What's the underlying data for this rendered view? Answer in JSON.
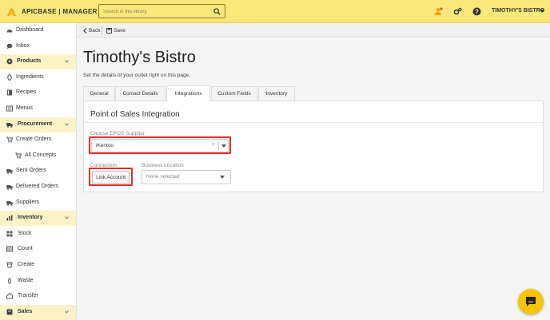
{
  "topbar": {
    "brand": "APICBASE | MANAGER",
    "search_placeholder": "Search in this library.",
    "user": "TIMOTHY'S BISTRO"
  },
  "sidebar": {
    "items": [
      {
        "label": "Dashboard",
        "icon": "dashboard-icon",
        "section": false
      },
      {
        "label": "Inbox",
        "icon": "inbox-icon",
        "section": false
      },
      {
        "label": "Products",
        "icon": "products-icon",
        "section": true
      },
      {
        "label": "Ingredients",
        "icon": "ingredients-icon",
        "section": false
      },
      {
        "label": "Recipes",
        "icon": "recipes-icon",
        "section": false
      },
      {
        "label": "Menus",
        "icon": "menus-icon",
        "section": false
      },
      {
        "label": "Procurement",
        "icon": "procurement-icon",
        "section": true
      },
      {
        "label": "Create Orders",
        "icon": "cart-icon",
        "section": false
      },
      {
        "label": "All Concepts",
        "icon": "cart-icon",
        "section": false
      },
      {
        "label": "Sent Orders",
        "icon": "sent-icon",
        "section": false
      },
      {
        "label": "Delivered Orders",
        "icon": "truck-icon",
        "section": false
      },
      {
        "label": "Suppliers",
        "icon": "suppliers-icon",
        "section": false
      },
      {
        "label": "Inventory",
        "icon": "inventory-icon",
        "section": true
      },
      {
        "label": "Stock",
        "icon": "stock-icon",
        "section": false
      },
      {
        "label": "Count",
        "icon": "count-icon",
        "section": false
      },
      {
        "label": "Create",
        "icon": "create-icon",
        "section": false
      },
      {
        "label": "Waste",
        "icon": "waste-icon",
        "section": false
      },
      {
        "label": "Transfer",
        "icon": "transfer-icon",
        "section": false
      },
      {
        "label": "Sales",
        "icon": "sales-icon",
        "section": true
      }
    ]
  },
  "toolbar": {
    "back_label": "Back",
    "save_label": "Save"
  },
  "page": {
    "title": "Timothy's Bistro",
    "description": "Set the details of your outlet right on this page."
  },
  "tabs": [
    {
      "label": "General",
      "active": false
    },
    {
      "label": "Contact Details",
      "active": false
    },
    {
      "label": "Integrations",
      "active": true
    },
    {
      "label": "Custom Fields",
      "active": false
    },
    {
      "label": "Inventory",
      "active": false
    }
  ],
  "integration": {
    "title": "Point of Sales Integration",
    "supplier_label": "Choose EPOS Supplier",
    "supplier_value": "iKentoo",
    "connection_label": "Connection",
    "link_button": "Link Account",
    "location_label": "Business Location",
    "location_value": "None selected",
    "clear_glyph": "×"
  },
  "colors": {
    "accent": "#fbe77a",
    "highlight": "#e53223",
    "chat": "#f6c500"
  }
}
